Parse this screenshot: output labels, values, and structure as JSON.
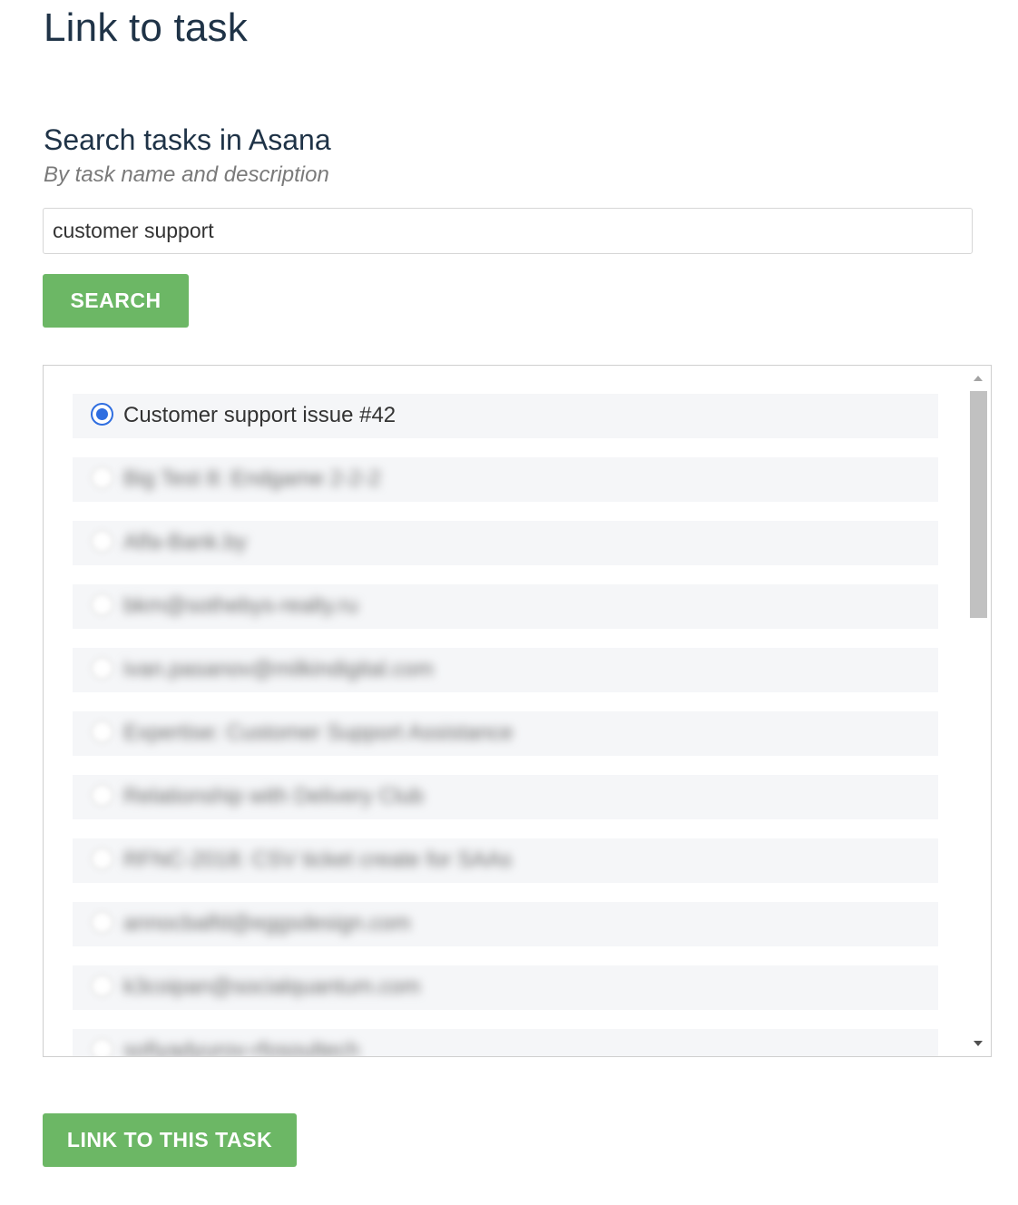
{
  "page": {
    "title": "Link to task"
  },
  "search": {
    "heading": "Search tasks in Asana",
    "subheading": "By task name and description",
    "query": "customer support",
    "button_label": "SEARCH"
  },
  "results": {
    "selected_index": 0,
    "items": [
      {
        "label": "Customer support issue #42",
        "selected": true,
        "blurred": false
      },
      {
        "label": "Big Test 8: Endgame 2-2-2",
        "selected": false,
        "blurred": true
      },
      {
        "label": "Alfa-Bank.by",
        "selected": false,
        "blurred": true
      },
      {
        "label": "bkm@sothebys-realty.ru",
        "selected": false,
        "blurred": true
      },
      {
        "label": "ivan.pasanov@milkindigital.com",
        "selected": false,
        "blurred": true
      },
      {
        "label": "Expertise: Customer Support Assistance",
        "selected": false,
        "blurred": true
      },
      {
        "label": "Relationship with Delivery Club",
        "selected": false,
        "blurred": true
      },
      {
        "label": "RFNC-2018: CSV ticket create for SAAs",
        "selected": false,
        "blurred": true
      },
      {
        "label": "annocbalfd@eggsdesign.com",
        "selected": false,
        "blurred": true
      },
      {
        "label": "k3coipan@socialquantum.com",
        "selected": false,
        "blurred": true
      },
      {
        "label": "sofiyadyurov-rfosoultech",
        "selected": false,
        "blurred": true
      }
    ]
  },
  "actions": {
    "link_button_label": "LINK TO THIS TASK"
  },
  "colors": {
    "primary_button": "#6cb765",
    "radio_selected": "#2f6ee0",
    "heading_text": "#1f3347"
  }
}
